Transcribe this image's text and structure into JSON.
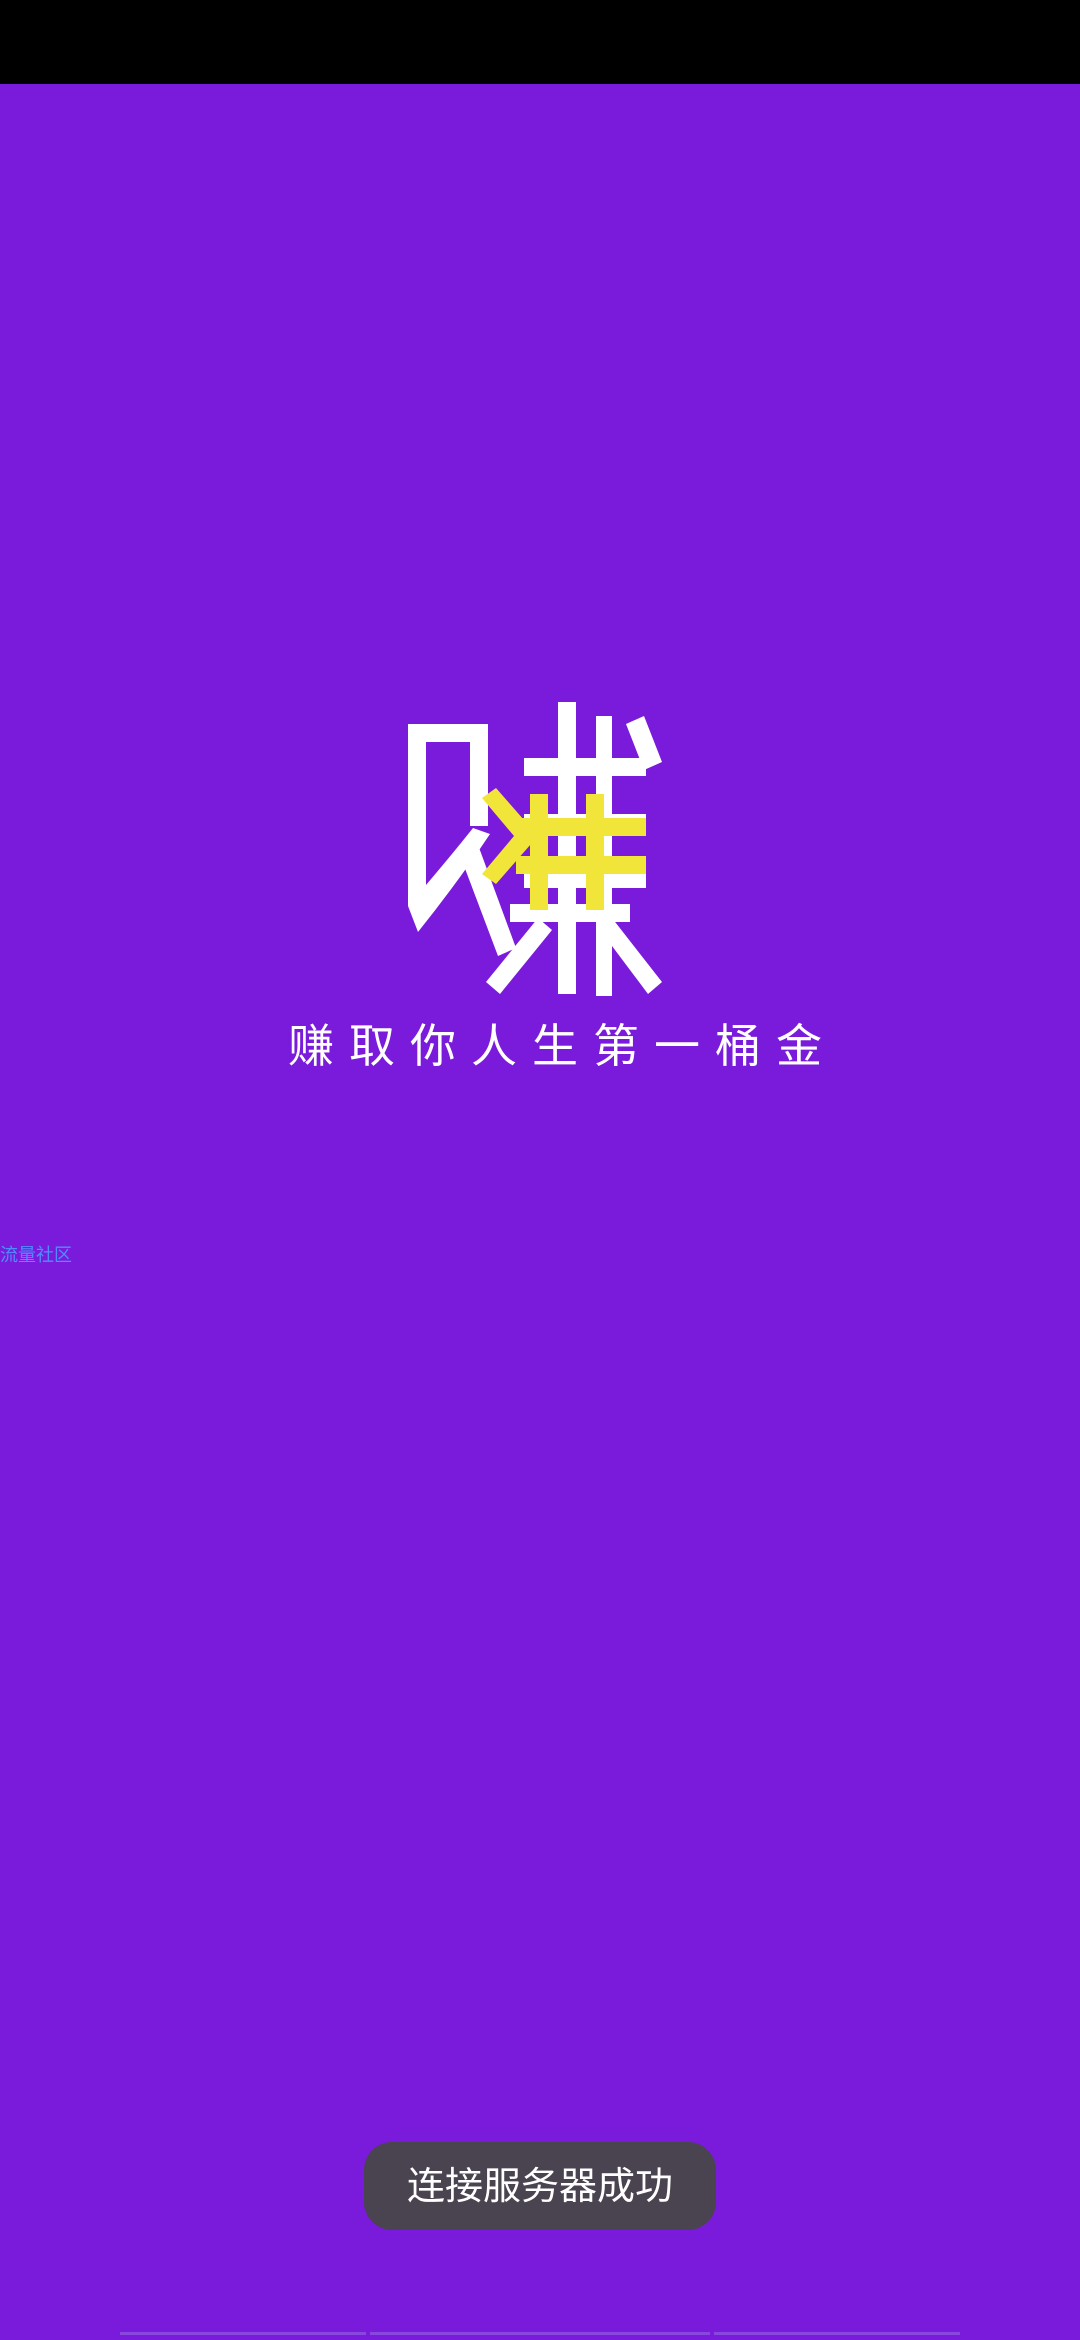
{
  "status_bar": {
    "visible": true
  },
  "splash": {
    "logo": {
      "character": "赚",
      "icon": "earn-logo-icon",
      "colors": {
        "primary": "#ffffff",
        "accent": "#f2e53a"
      }
    },
    "slogan": "赚取你人生第一桶金",
    "community_link": "流量社区",
    "toast": "连接服务器成功",
    "background_color": "#7a1adb"
  }
}
